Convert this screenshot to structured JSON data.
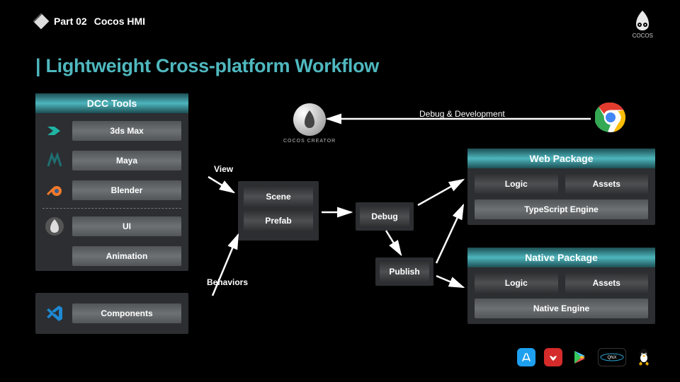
{
  "breadcrumb": {
    "part": "Part 02",
    "section": "Cocos HMI"
  },
  "logo_label": "COCOS",
  "title": "Lightweight Cross-platform Workflow",
  "dcc": {
    "header": "DCC Tools",
    "items_top": [
      "3ds Max",
      "Maya",
      "Blender"
    ],
    "items_mid": [
      "UI",
      "Animation"
    ]
  },
  "creator_label": "COCOS CREATOR",
  "vscode": {
    "label": "Components"
  },
  "scene": [
    "Scene",
    "Prefab"
  ],
  "debug": "Debug",
  "publish": "Publish",
  "web": {
    "header": "Web Package",
    "left": "Logic",
    "right": "Assets",
    "engine": "TypeScript Engine"
  },
  "native": {
    "header": "Native Package",
    "left": "Logic",
    "right": "Assets",
    "engine": "Native Engine"
  },
  "labels": {
    "view": "View",
    "behaviors": "Behaviors",
    "debug_dev": "Debug & Development"
  },
  "platforms": [
    "appstore",
    "huawei",
    "playstore",
    "qnx",
    "linux"
  ]
}
